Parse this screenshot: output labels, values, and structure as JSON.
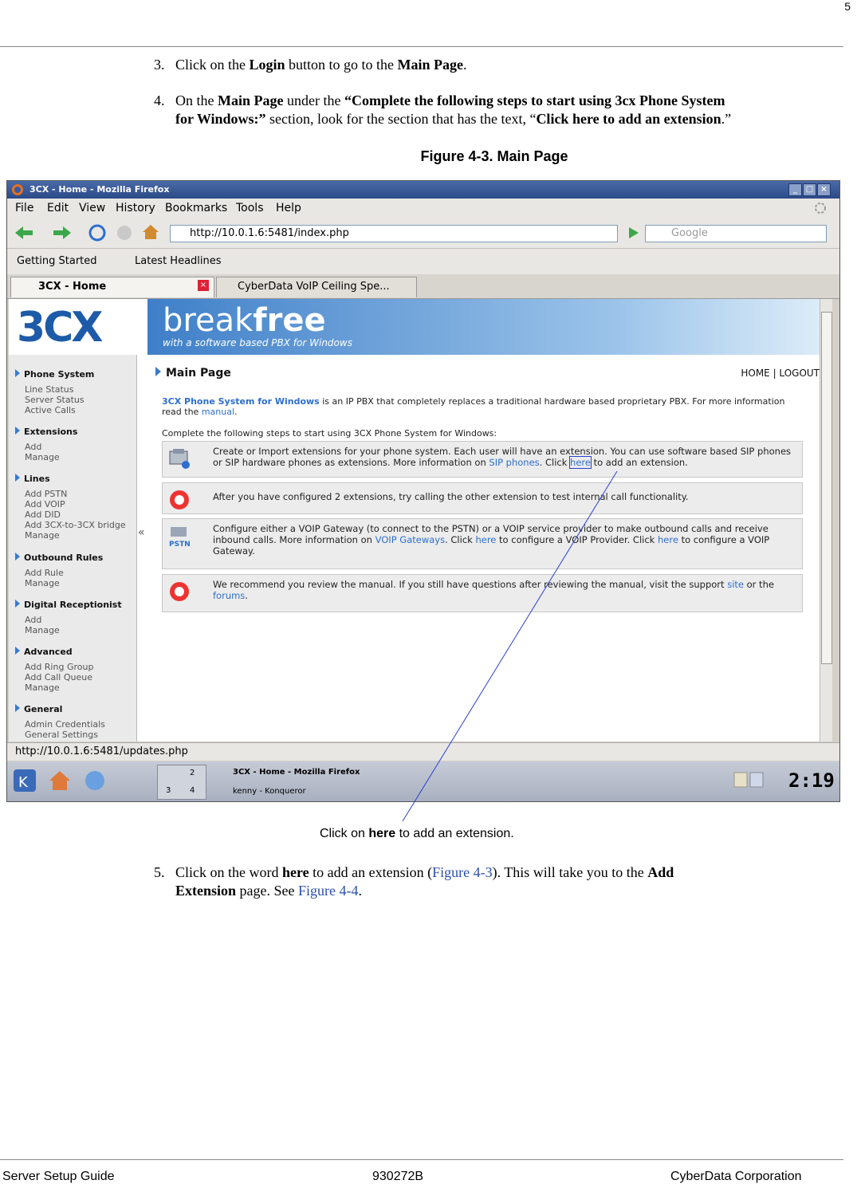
{
  "page_number": "5",
  "steps": {
    "s3": {
      "num": "3.",
      "pre": "Click on the ",
      "b1": "Login",
      "mid": " button to go to the ",
      "b2": "Main Page",
      "post": "."
    },
    "s4": {
      "num": "4.",
      "pre": "On the ",
      "b1": "Main Page",
      "mid": " under the ",
      "b2": "“Complete the following steps to start using 3cx Phone System",
      "b3": "for Windows:”",
      "mid2": " section, look for the section that has the text, “",
      "b4": "Click here to add an extension",
      "post": ".”"
    },
    "s5": {
      "num": "5.",
      "pre": "Click on the word ",
      "b1": "here",
      "mid": " to add an extension (",
      "ref1": "Figure 4-3",
      "mid2": "). This will take you to the ",
      "b2": "Add",
      "b3": "Extension",
      "mid3": " page. See ",
      "ref2": "Figure 4-4",
      "post": "."
    }
  },
  "figure_title": "Figure 4-3. Main Page",
  "callout": {
    "pre": "Click on ",
    "bold": "here",
    "post": " to add an extension."
  },
  "footer": {
    "left": "Server Setup Guide",
    "center": "930272B",
    "right": "CyberData Corporation"
  },
  "browser": {
    "window_title": "3CX - Home - Mozilla Firefox",
    "menu": [
      "File",
      "Edit",
      "View",
      "History",
      "Bookmarks",
      "Tools",
      "Help"
    ],
    "url": "http://10.0.1.6:5481/index.php",
    "search_placeholder": "Google",
    "bookmarks": [
      "Getting Started",
      "Latest Headlines"
    ],
    "tabs": [
      "3CX - Home",
      "CyberData VoIP Ceiling Spe..."
    ],
    "status_url": "http://10.0.1.6:5481/updates.php"
  },
  "site": {
    "logo": "3CX",
    "banner_a": "break",
    "banner_b": "free",
    "tagline": "with a software based PBX for Windows",
    "sidebar": [
      {
        "head": "Phone System",
        "items": [
          "Line Status",
          "Server Status",
          "Active Calls"
        ]
      },
      {
        "head": "Extensions",
        "items": [
          "Add",
          "Manage"
        ]
      },
      {
        "head": "Lines",
        "items": [
          "Add PSTN",
          "Add VOIP",
          "Add DID",
          "Add 3CX-to-3CX bridge",
          "Manage"
        ]
      },
      {
        "head": "Outbound Rules",
        "items": [
          "Add Rule",
          "Manage"
        ]
      },
      {
        "head": "Digital Receptionist",
        "items": [
          "Add",
          "Manage"
        ]
      },
      {
        "head": "Advanced",
        "items": [
          "Add Ring Group",
          "Add Call Queue",
          "Manage"
        ]
      },
      {
        "head": "General",
        "items": [
          "Admin Credentials",
          "General Settings"
        ]
      }
    ],
    "collapse": "«",
    "main_title": "Main Page",
    "home_links": "HOME | LOGOUT",
    "intro_link": "3CX Phone System for Windows",
    "intro_text": " is an IP PBX that completely replaces a traditional hardware based proprietary PBX. For more information read the ",
    "intro_manual": "manual",
    "intro_end": ".",
    "steps_label": "Complete the following steps to start using 3CX Phone System for Windows:",
    "box1": {
      "a": "Create or Import extensions for your phone system. Each user will have an extension. You can use software based SIP phones or SIP hardware phones as extensions. More information on ",
      "link1": "SIP phones",
      "b": ". Click ",
      "link2": "here",
      "c": " to add an extension."
    },
    "box2": {
      "a": "After you have configured 2 extensions, try calling the other extension to test internal call functionality."
    },
    "box3": {
      "a": "Configure either a VOIP Gateway (to connect to the PSTN) or a VOIP service provider to make outbound calls and receive inbound calls. More information on ",
      "link1": "VOIP Gateways",
      "b": ". Click ",
      "link2": "here",
      "c": " to configure a VOIP Provider. Click ",
      "link3": "here",
      "d": " to configure a VOIP Gateway."
    },
    "box4": {
      "a": "We recommend you review the manual. If you still have questions after reviewing the manual, visit the support ",
      "link1": "site",
      "b": " or the ",
      "link2": "forums",
      "c": "."
    }
  },
  "taskbar": {
    "desk": [
      "2",
      "3",
      "4"
    ],
    "task1": "3CX - Home - Mozilla Firefox",
    "task2": "kenny - Konqueror",
    "clock": "2:19"
  },
  "colors": {
    "link": "#2d6ed0",
    "xref": "#2a4fb0",
    "callout_line": "#2a3fd0"
  }
}
